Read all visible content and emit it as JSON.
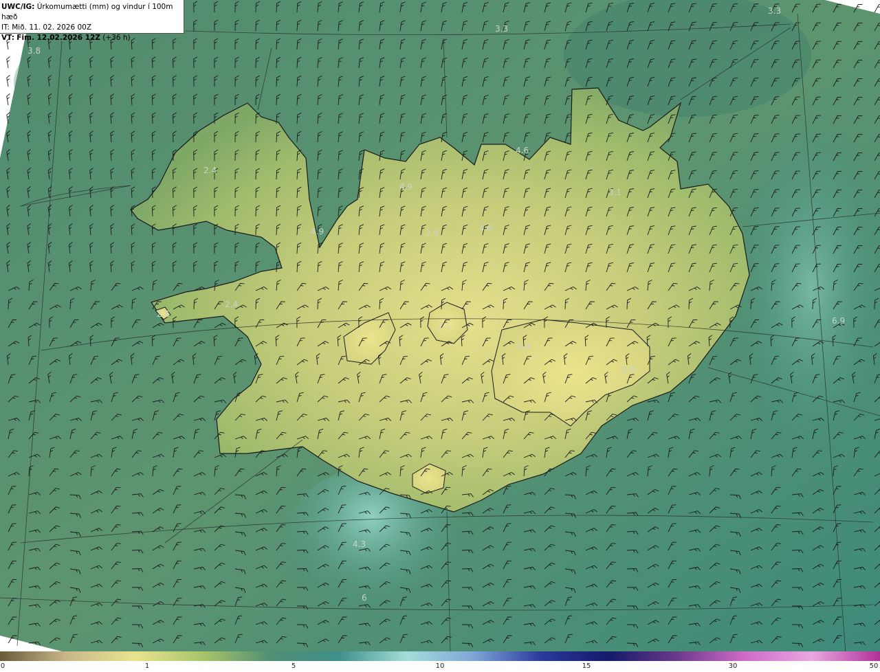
{
  "header": {
    "model_code": "UWC/IG:",
    "title": "Úrkomumætti (mm) og vindur í 100m hæð",
    "init_prefix": "IT:",
    "init_time": "Mið. 11. 02. 2026 00Z",
    "valid_prefix": "VT:",
    "valid_time": "Fim. 12.02.2026 12Z",
    "lead": "(+36 h)"
  },
  "value_labels": [
    {
      "text": "3.3",
      "id": "lbl-1"
    },
    {
      "text": "3.3",
      "id": "lbl-2"
    },
    {
      "text": "3.8",
      "id": "lbl-3"
    },
    {
      "text": "4.6",
      "id": "lbl-4"
    },
    {
      "text": "4.9",
      "id": "lbl-5"
    },
    {
      "text": "2.4",
      "id": "lbl-6"
    },
    {
      "text": "3.1",
      "id": "lbl-7"
    },
    {
      "text": "4.9",
      "id": "lbl-8"
    },
    {
      "text": "2.9",
      "id": "lbl-9"
    },
    {
      "text": "4.6",
      "id": "lbl-10"
    },
    {
      "text": "2.4",
      "id": "lbl-11"
    },
    {
      "text": "2.6",
      "id": "lbl-12"
    },
    {
      "text": "2.1",
      "id": "lbl-13"
    },
    {
      "text": "6.9",
      "id": "lbl-14"
    },
    {
      "text": "3.9",
      "id": "lbl-15"
    },
    {
      "text": "0.9",
      "id": "lbl-16"
    },
    {
      "text": "4.3",
      "id": "lbl-17"
    },
    {
      "text": "6",
      "id": "lbl-18"
    }
  ],
  "colorbar": {
    "ticks": [
      "0",
      "1",
      "5",
      "10",
      "15",
      "30",
      "50"
    ],
    "colors": [
      "#6b5a3a",
      "#c9b98a",
      "#e8e48e",
      "#a8c46a",
      "#4f8f74",
      "#3f8f8a",
      "#a4ddd8",
      "#7fa6d8",
      "#2a3a9a",
      "#141a6a",
      "#6a3a8a",
      "#d06ac8",
      "#e8a8e0",
      "#b0309a"
    ]
  },
  "colors": {
    "sea_dark": "#2f7a6c",
    "sea_mid": "#4e8d72",
    "land_mid": "#9bb868",
    "land_high": "#dedd8a",
    "coast": "#1a1a1a",
    "barb": "#1a1a1a"
  }
}
